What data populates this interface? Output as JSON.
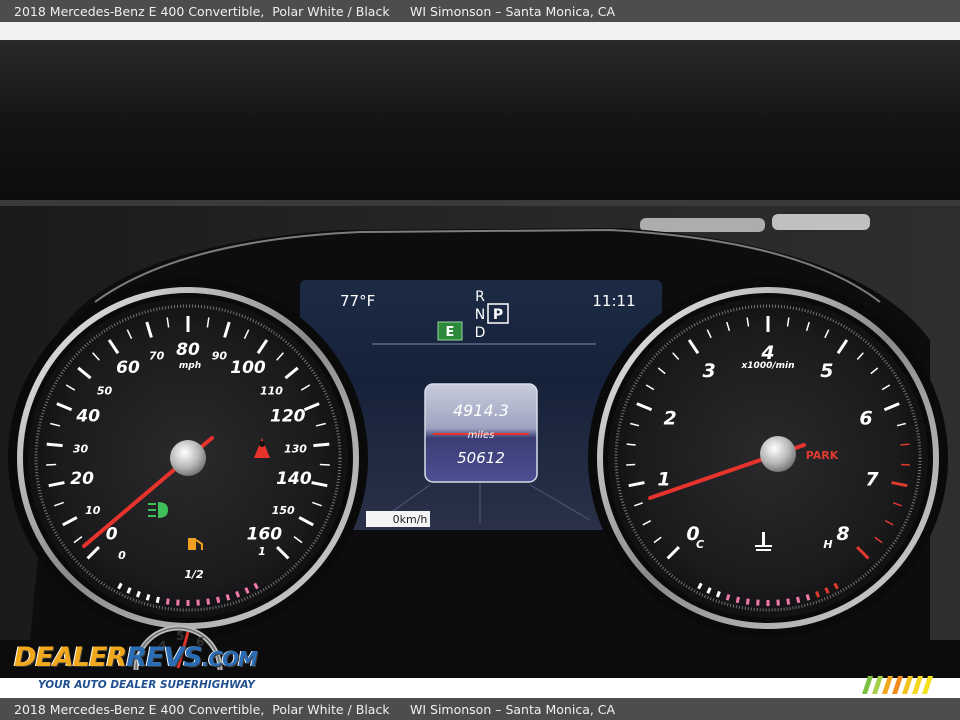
{
  "caption": {
    "car": "2018 Mercedes-Benz E 400 Convertible,",
    "color": "Polar White / Black",
    "dealer": "WI Simonson – Santa Monica, CA"
  },
  "speedometer": {
    "unit": "mph",
    "labels": [
      "0",
      "10",
      "20",
      "30",
      "40",
      "50",
      "60",
      "70",
      "80",
      "90",
      "100",
      "110",
      "120",
      "130",
      "140",
      "150",
      "160"
    ],
    "fuel_labels": [
      "0",
      "1/2",
      "1"
    ]
  },
  "tachometer": {
    "unit": "x1000/min",
    "labels": [
      "0",
      "1",
      "2",
      "3",
      "4",
      "5",
      "6",
      "7",
      "8"
    ],
    "park_label": "PARK",
    "temp_labels": [
      "C",
      "H"
    ]
  },
  "display": {
    "temperature": "77°F",
    "gear_top": "R",
    "gear_mid": "N",
    "gear_selected": "P",
    "gear_bottom": "D",
    "time": "11:11",
    "eco_badge": "E",
    "trip_value": "4914.3",
    "trip_unit": "miles",
    "odometer": "50612",
    "speed_readout": "0km/h"
  },
  "watermark": {
    "brand_a": "DEALER",
    "brand_b": "REVS",
    "brand_c": ".COM",
    "tagline": "YOUR AUTO DEALER SUPERHIGHWAY",
    "dial_digits": [
      "4",
      "5",
      "6"
    ]
  },
  "colors": {
    "needle": "#e8332d",
    "caption_bg": "#4d4d4d",
    "eco_green": "#2c8a3a",
    "park_red": "#e03a2e",
    "gauge_face": "#1c1c1e"
  }
}
